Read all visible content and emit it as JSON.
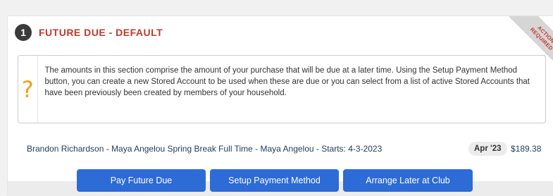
{
  "ribbon": {
    "line1": "ACTION",
    "line2": "REQUIRED"
  },
  "section": {
    "step_number": "1",
    "title": "FUTURE DUE - DEFAULT"
  },
  "info": {
    "icon": "question-mark-icon",
    "text": "The amounts in this section comprise the amount of your purchase that will be due at a later time. Using the Setup Payment Method button, you can create a new Stored Account to be used when these are due or you can select from a list of active Stored Accounts that have been previously been created by members of your household."
  },
  "item": {
    "description": "Brandon Richardson - Maya Angelou Spring Break Full Time - Maya Angelou - Starts: 4-3-2023",
    "date": "Apr '23",
    "amount": "$189.38"
  },
  "buttons": {
    "pay": "Pay Future Due",
    "setup": "Setup Payment Method",
    "arrange": "Arrange Later at Club"
  },
  "colors": {
    "accent_red": "#c0392b",
    "button_blue": "#2d6bd6",
    "icon_orange": "#f0a21b"
  }
}
